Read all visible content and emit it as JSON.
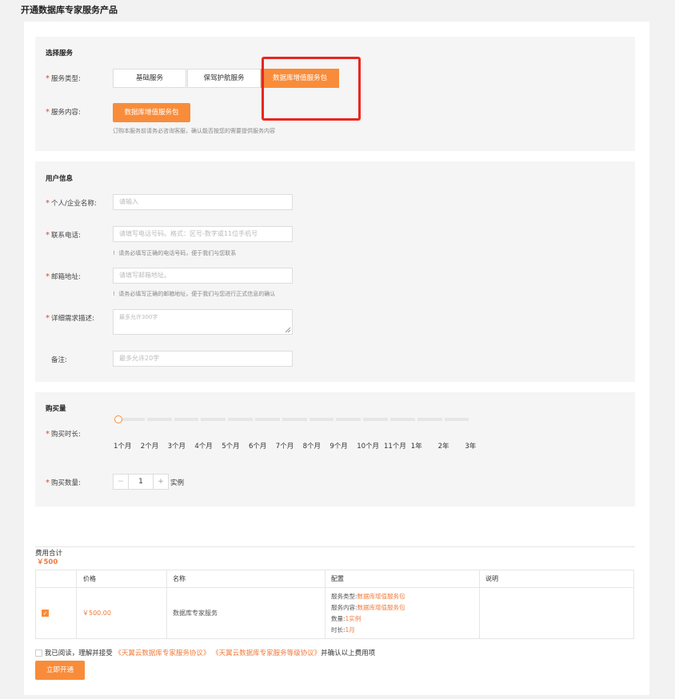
{
  "page": {
    "title": "开通数据库专家服务产品"
  },
  "service": {
    "section_title": "选择服务",
    "type_label": "服务类型:",
    "types": [
      "基础服务",
      "保驾护航服务",
      "数据库增值服务包"
    ],
    "content_label": "服务内容:",
    "content_button": "数据库增值服务包",
    "content_hint": "订购本服务前请务必咨询客服，确认能否按您的需要提供服务内容"
  },
  "user": {
    "section_title": "用户信息",
    "name_label": "个人/企业名称:",
    "name_placeholder": "请输入",
    "phone_label": "联系电话:",
    "phone_placeholder": "请填写电话号码。格式：区号-数字或11位手机号",
    "phone_hint": "请务必填写正确的电话号码，便于我们与您联系",
    "email_label": "邮箱地址:",
    "email_placeholder": "请填写邮箱地址。",
    "email_hint": "请务必填写正确的邮箱地址，便于我们与您进行正式信息的确认",
    "desc_label": "详细需求描述:",
    "desc_placeholder": "最多允许300字",
    "note_label": "备注:",
    "note_placeholder": "最多允许20字"
  },
  "purchase": {
    "section_title": "购买量",
    "duration_label": "购买时长:",
    "durations": [
      "1个月",
      "2个月",
      "3个月",
      "4个月",
      "5个月",
      "6个月",
      "7个月",
      "8个月",
      "9个月",
      "10个月",
      "11个月",
      "1年",
      "2年",
      "3年"
    ],
    "selected_duration_index": 0,
    "qty_label": "购买数量:",
    "qty_minus": "−",
    "qty_value": "1",
    "qty_plus": "+",
    "qty_unit": "实例"
  },
  "fee": {
    "total_label": "费用合计",
    "total_value": "￥500",
    "columns": [
      "",
      "价格",
      "名称",
      "配置",
      "说明"
    ],
    "row": {
      "price": "￥500.00",
      "name": "数据库专家服务",
      "config": [
        {
          "k": "服务类型:",
          "v": "数据库增值服务包"
        },
        {
          "k": "服务内容:",
          "v": "数据库增值服务包"
        },
        {
          "k": "数量:",
          "v": "1实例"
        },
        {
          "k": "时长:",
          "v": "1月"
        }
      ],
      "note": ""
    }
  },
  "agreement": {
    "prefix": "我已阅读，理解并接受",
    "link1": "《天翼云数据库专家服务协议》",
    "link2": "《天翼云数据库专家服务等级协议》",
    "suffix": "并确认以上费用项"
  },
  "submit_label": "立即开通",
  "colors": {
    "accent": "#f98c3a",
    "required": "#e5442e",
    "highlight_box": "#e8261f"
  }
}
